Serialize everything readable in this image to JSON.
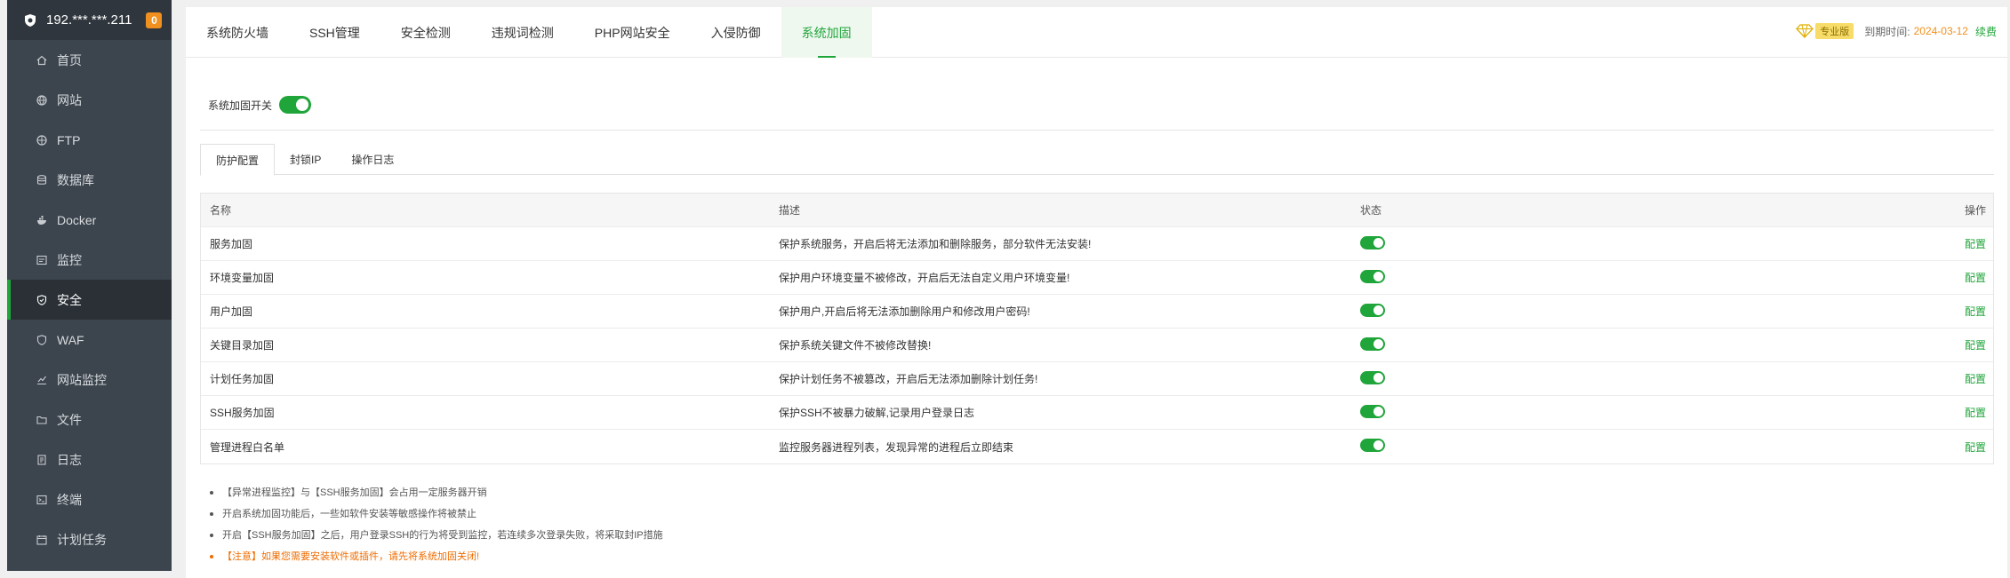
{
  "sidebar": {
    "server_ip": "192.***.***.211",
    "badge_count": "0",
    "items": [
      {
        "label": "首页",
        "icon": "home-icon"
      },
      {
        "label": "网站",
        "icon": "globe-icon"
      },
      {
        "label": "FTP",
        "icon": "ftp-icon"
      },
      {
        "label": "数据库",
        "icon": "database-icon"
      },
      {
        "label": "Docker",
        "icon": "docker-icon"
      },
      {
        "label": "监控",
        "icon": "monitor-icon"
      },
      {
        "label": "安全",
        "icon": "shield-check-icon"
      },
      {
        "label": "WAF",
        "icon": "waf-shield-icon"
      },
      {
        "label": "网站监控",
        "icon": "chart-icon"
      },
      {
        "label": "文件",
        "icon": "folder-icon"
      },
      {
        "label": "日志",
        "icon": "log-icon"
      },
      {
        "label": "终端",
        "icon": "terminal-icon"
      },
      {
        "label": "计划任务",
        "icon": "calendar-icon"
      }
    ],
    "active_index": 6
  },
  "header": {
    "tabs": [
      "系统防火墙",
      "SSH管理",
      "安全检测",
      "违规词检测",
      "PHP网站安全",
      "入侵防御",
      "系统加固"
    ],
    "active_tab": 6,
    "vip_tag": "专业版",
    "expire_label": "到期时间:",
    "expire_date": "2024-03-12",
    "renew_label": "续费"
  },
  "hardening": {
    "switch_label": "系统加固开关",
    "switch_on": true,
    "subtabs": [
      "防护配置",
      "封锁IP",
      "操作日志"
    ],
    "active_subtab": 0,
    "columns": {
      "name": "名称",
      "desc": "描述",
      "status": "状态",
      "action": "操作"
    },
    "rows": [
      {
        "name": "服务加固",
        "desc": "保护系统服务，开启后将无法添加和删除服务，部分软件无法安装!",
        "enabled": true,
        "action": "配置"
      },
      {
        "name": "环境变量加固",
        "desc": "保护用户环境变量不被修改，开启后无法自定义用户环境变量!",
        "enabled": true,
        "action": "配置"
      },
      {
        "name": "用户加固",
        "desc": "保护用户,开启后将无法添加删除用户和修改用户密码!",
        "enabled": true,
        "action": "配置"
      },
      {
        "name": "关键目录加固",
        "desc": "保护系统关键文件不被修改替换!",
        "enabled": true,
        "action": "配置"
      },
      {
        "name": "计划任务加固",
        "desc": "保护计划任务不被篡改，开启后无法添加删除计划任务!",
        "enabled": true,
        "action": "配置"
      },
      {
        "name": "SSH服务加固",
        "desc": "保护SSH不被暴力破解,记录用户登录日志",
        "enabled": true,
        "action": "配置"
      },
      {
        "name": "管理进程白名单",
        "desc": "监控服务器进程列表，发现异常的进程后立即结束",
        "enabled": true,
        "action": "配置"
      }
    ],
    "notes": [
      "【异常进程监控】与【SSH服务加固】会占用一定服务器开销",
      "开启系统加固功能后，一些如软件安装等敏感操作将被禁止",
      "开启【SSH服务加固】之后，用户登录SSH的行为将受到监控，若连续多次登录失败，将采取封IP措施",
      "【注意】如果您需要安装软件或插件，请先将系统加固关闭!"
    ]
  },
  "colors": {
    "accent": "#20a53a",
    "warning": "#ef6c00",
    "sidebar_bg": "#3c444d"
  }
}
